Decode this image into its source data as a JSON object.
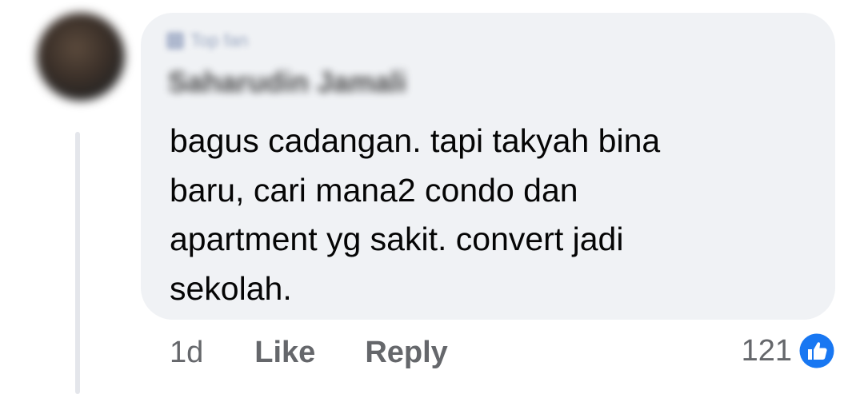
{
  "comment": {
    "author_badge": "Top fan",
    "author_name": "Saharudin Jamali",
    "text_lines": [
      "bagus cadangan. tapi takyah bina",
      "baru, cari mana2 condo dan",
      "apartment yg sakit. convert jadi",
      "sekolah."
    ],
    "time": "1d",
    "like_label": "Like",
    "reply_label": "Reply",
    "reaction_count": "121",
    "reaction_icon": "like-thumbs-up-icon",
    "colors": {
      "bubble": "#f0f2f5",
      "meta_text": "#65676b",
      "like_blue": "#1877f2"
    }
  }
}
